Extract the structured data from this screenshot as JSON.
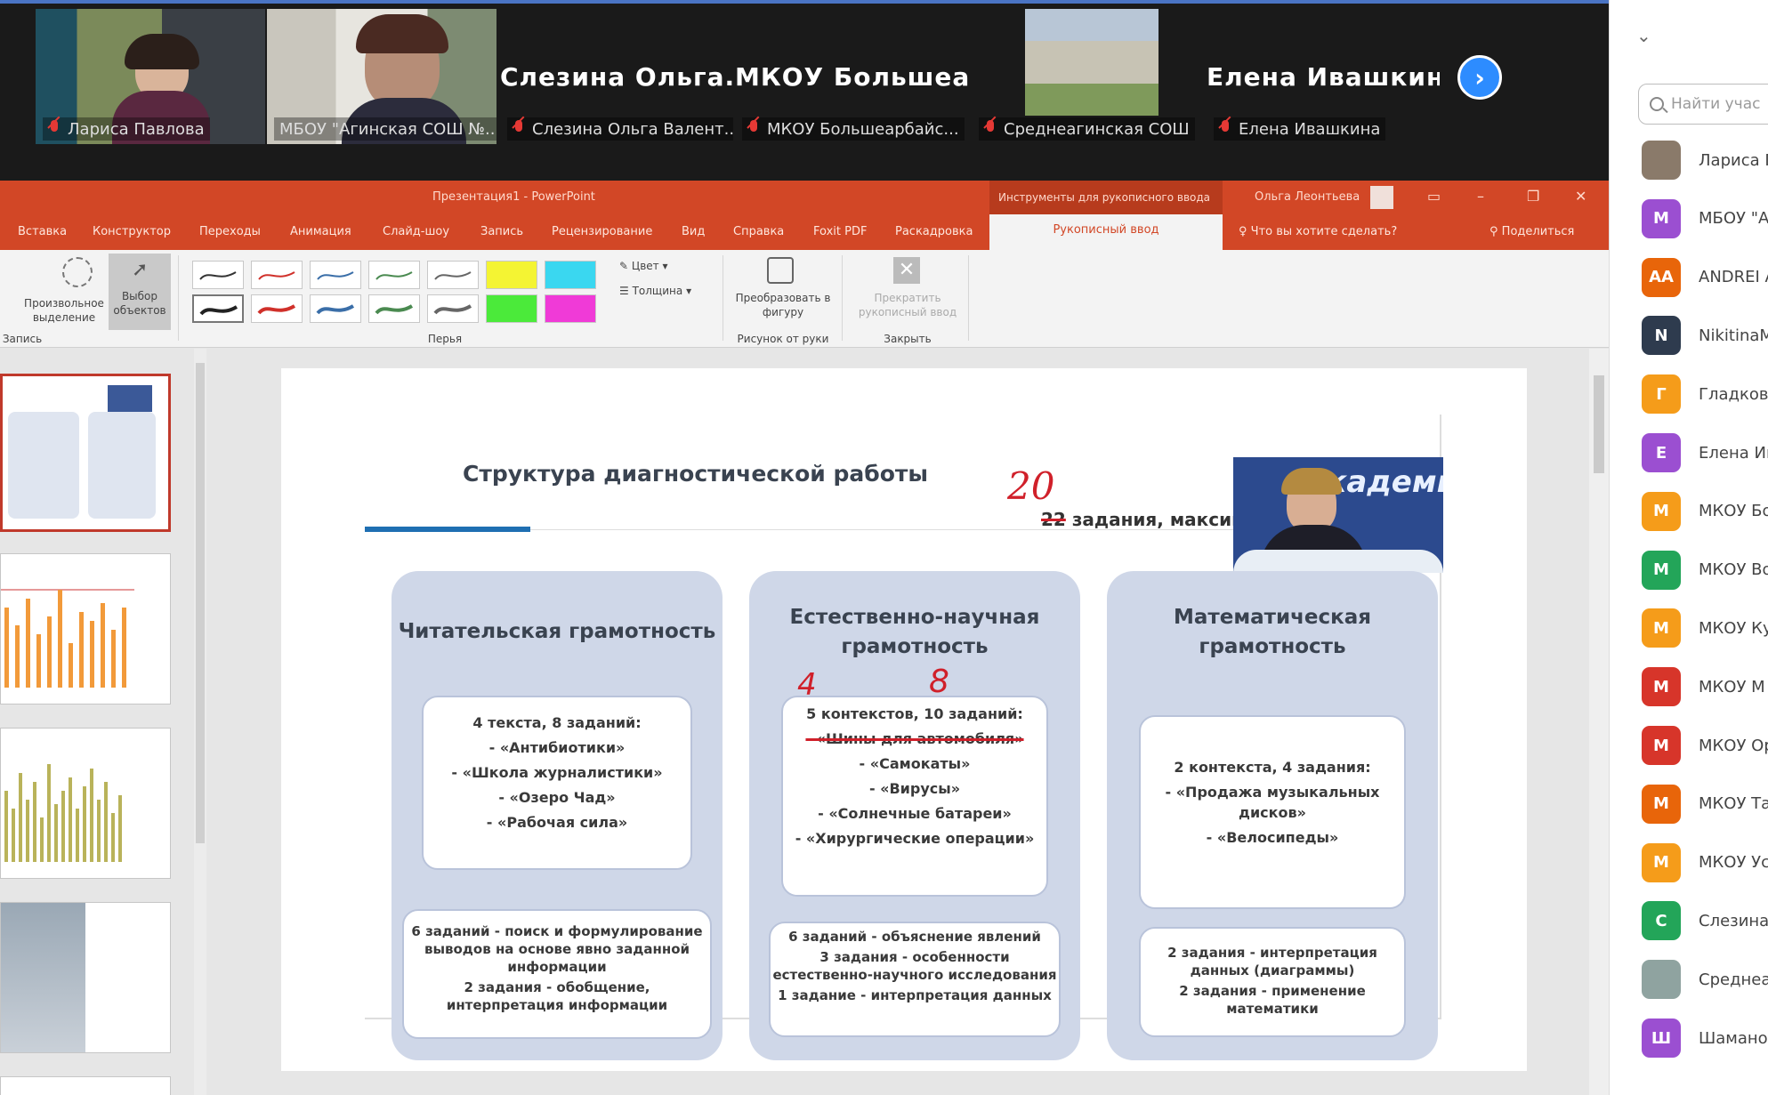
{
  "video": {
    "tiles": [
      {
        "label": "Лариса Павлова"
      },
      {
        "label": "МБОУ \"Агинская СОШ №..."
      },
      {
        "name": "Слезина Ольга...",
        "label": "Слезина Ольга Валент..."
      },
      {
        "name": "МКОУ Большеа...",
        "label": "МКОУ Большеарбайс..."
      },
      {
        "label": "Среднеагинская СОШ"
      },
      {
        "name": "Елена Ивашкина",
        "label": "Елена Ивашкина"
      }
    ]
  },
  "ppt": {
    "title": "Презентация1 - PowerPoint",
    "contextual_tools": "Инструменты для рукописного ввода",
    "user": "Ольга Леонтьева",
    "tabs": [
      "Вставка",
      "Конструктор",
      "Переходы",
      "Анимация",
      "Слайд-шоу",
      "Запись",
      "Рецензирование",
      "Вид",
      "Справка",
      "Foxit PDF",
      "Раскадровка"
    ],
    "active_tab": "Рукописный ввод",
    "tell_me": "Что вы хотите сделать?",
    "share": "Поделиться",
    "ribbon": {
      "lasso": "Произвольное выделение",
      "select": "Выбор объектов",
      "group_write": "Запись",
      "group_pens": "Перья",
      "color": "Цвет",
      "thickness": "Толщина",
      "convert": "Преобразовать в фигуру",
      "group_convert": "Рисунок от руки",
      "close_ink": "Прекратить рукописный ввод",
      "group_close": "Закрыть"
    }
  },
  "slide": {
    "title": "Структура диагностической работы",
    "handwritten_num": "20",
    "struck_num": "22",
    "tasks_text": "задания, максималь",
    "cam_brand": "АкадемиЯ",
    "columns": [
      {
        "title": "Читательская грамотность",
        "items": [
          "4 текста, 8 заданий:",
          "- «Антибиотики»",
          "- «Школа журналистики»",
          "- «Озеро Чад»",
          "- «Рабочая сила»"
        ],
        "details": [
          "6 заданий - поиск и формулирование выводов на основе явно заданной информации",
          "2 задания - обобщение, интерпретация информации"
        ]
      },
      {
        "title": "Естественно-научная грамотность",
        "hand_4": "4",
        "hand_8": "8",
        "items": [
          "5 контекстов, 10 заданий:",
          "- «Шины для автомобиля»",
          "- «Самокаты»",
          "- «Вирусы»",
          "- «Солнечные батареи»",
          "- «Хирургические операции»"
        ],
        "details": [
          "6 заданий - объяснение явлений",
          "3 задания - особенности естественно-научного исследования",
          "1 задание - интерпретация данных"
        ]
      },
      {
        "title": "Математическая грамотность",
        "items": [
          "2 контекста, 4 задания:",
          "- «Продажа музыкальных дисков»",
          "- «Велосипеды»"
        ],
        "details": [
          "2 задания - интерпретация данных (диаграммы)",
          "2 задания - применение математики"
        ]
      }
    ]
  },
  "participants": {
    "search_placeholder": "Найти учас",
    "list": [
      {
        "avatar": "",
        "color": "#8a7a6a",
        "name": "Лариса П"
      },
      {
        "avatar": "M",
        "color": "#9b4fd1",
        "name": "МБОУ \"А"
      },
      {
        "avatar": "AA",
        "color": "#e8650a",
        "name": "ANDREI A"
      },
      {
        "avatar": "N",
        "color": "#2e3b4e",
        "name": "NikitinaM"
      },
      {
        "avatar": "Г",
        "color": "#f59c1a",
        "name": "Гладкова"
      },
      {
        "avatar": "Е",
        "color": "#9b4fd1",
        "name": "Елена Ив"
      },
      {
        "avatar": "M",
        "color": "#f59c1a",
        "name": "МКОУ Бо"
      },
      {
        "avatar": "M",
        "color": "#23a559",
        "name": "МКОУ Во"
      },
      {
        "avatar": "M",
        "color": "#f59c1a",
        "name": "МКОУ Ку"
      },
      {
        "avatar": "M",
        "color": "#d7352a",
        "name": "МКОУ М"
      },
      {
        "avatar": "M",
        "color": "#d7352a",
        "name": "МКОУ Ор"
      },
      {
        "avatar": "M",
        "color": "#e8650a",
        "name": "МКОУ Та"
      },
      {
        "avatar": "M",
        "color": "#f59c1a",
        "name": "МКОУ Ус"
      },
      {
        "avatar": "С",
        "color": "#23a559",
        "name": "Слезина"
      },
      {
        "avatar": "",
        "color": "#8fa3a0",
        "name": "Среднеаг"
      },
      {
        "avatar": "Ш",
        "color": "#9b4fd1",
        "name": "Шамано"
      }
    ]
  }
}
